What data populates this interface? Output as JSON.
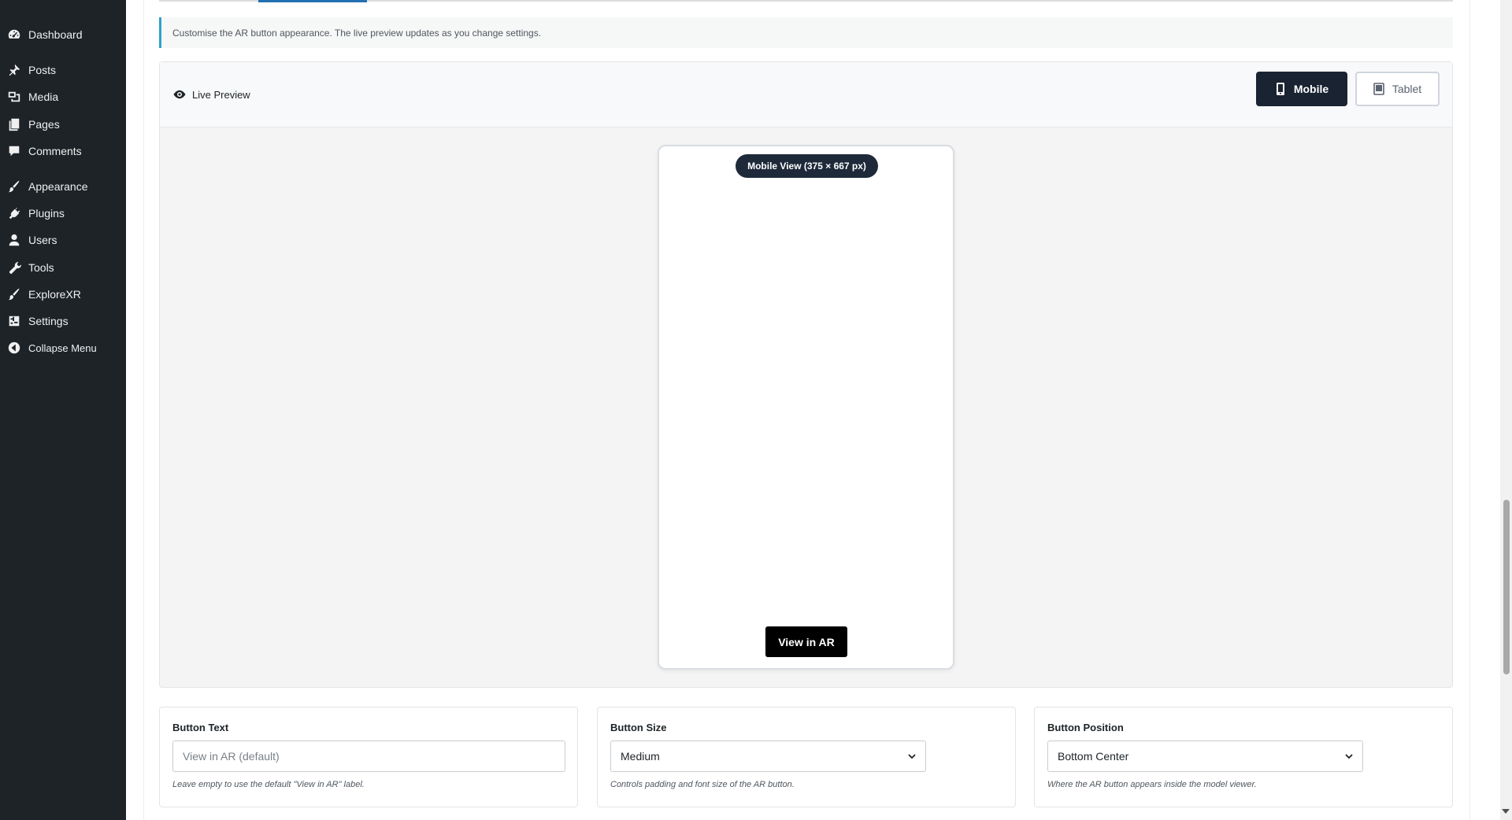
{
  "sidebar": {
    "items": [
      {
        "label": "Dashboard",
        "icon": "dashboard-icon"
      },
      {
        "label": "Posts",
        "icon": "pin-icon"
      },
      {
        "label": "Media",
        "icon": "media-icon"
      },
      {
        "label": "Pages",
        "icon": "pages-icon"
      },
      {
        "label": "Comments",
        "icon": "comment-icon"
      },
      {
        "label": "Appearance",
        "icon": "brush-icon"
      },
      {
        "label": "Plugins",
        "icon": "plug-icon"
      },
      {
        "label": "Users",
        "icon": "user-icon"
      },
      {
        "label": "Tools",
        "icon": "wrench-icon"
      },
      {
        "label": "ExploreXR",
        "icon": "brush-icon"
      },
      {
        "label": "Settings",
        "icon": "sliders-icon"
      },
      {
        "label": "Collapse Menu",
        "icon": "collapse-icon"
      }
    ]
  },
  "notice": {
    "text": "Customise the AR button appearance. The live preview updates as you change settings."
  },
  "preview": {
    "title": "Live Preview",
    "devices": {
      "mobile": "Mobile",
      "tablet": "Tablet",
      "active": "Mobile"
    },
    "badge": "Mobile View (375 × 667 px)",
    "ar_button_label": "View in AR"
  },
  "fields": {
    "button_text": {
      "label": "Button Text",
      "placeholder": "View in AR (default)",
      "value": "",
      "help": "Leave empty to use the default \"View in AR\" label."
    },
    "button_size": {
      "label": "Button Size",
      "value": "Medium",
      "help": "Controls padding and font size of the AR button."
    },
    "button_position": {
      "label": "Button Position",
      "value": "Bottom Center",
      "help": "Where the AR button appears inside the model viewer."
    }
  },
  "colors": {
    "sidebar_bg": "#1d2327",
    "accent": "#2271b1",
    "notice_border": "#2ea2cc",
    "device_active_bg": "#1a2332",
    "ar_button_bg": "#000000"
  }
}
